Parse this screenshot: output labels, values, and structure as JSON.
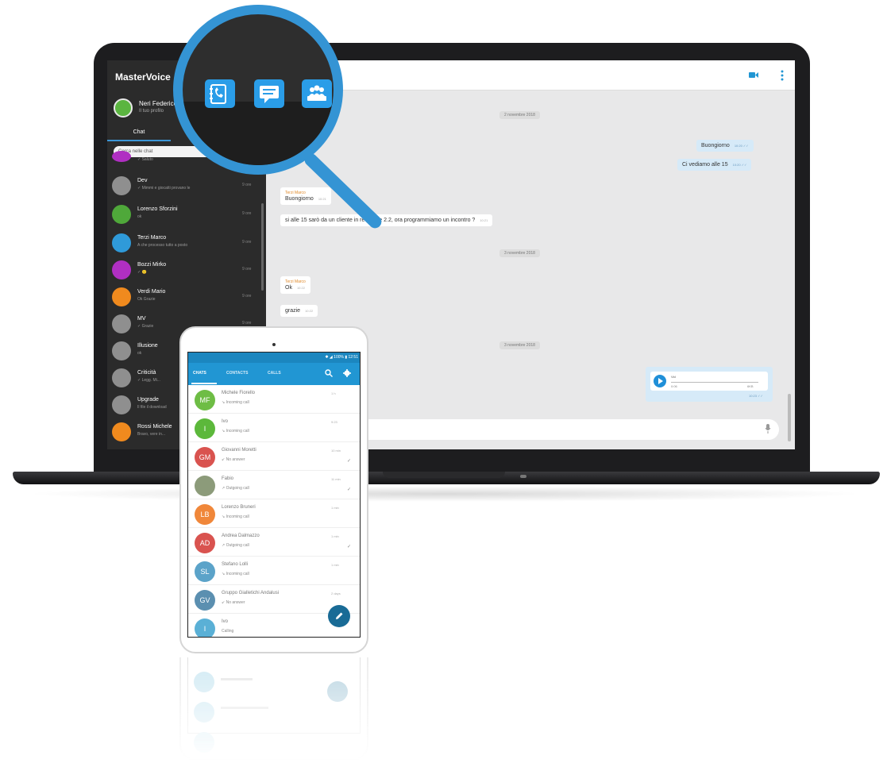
{
  "desktop_app": {
    "title": "MasterVoice",
    "profile": {
      "name": "Neri Federico",
      "status": "Il tuo profilo"
    },
    "tab_chat": "Chat",
    "search_placeholder": "Cerca nelle chat",
    "contacts": [
      {
        "name": "",
        "sub": "✓ Saluto",
        "time": "",
        "color": "#b02fc2"
      },
      {
        "name": "Dev",
        "sub": "✓ Mimmi e giocatti provano le",
        "time": "9 ore",
        "color": "#8f8f8f"
      },
      {
        "name": "Lorenzo Sforzini",
        "sub": "ok",
        "time": "9 ore",
        "color": "#4fa83a"
      },
      {
        "name": "Terzi Marco",
        "sub": "A che processo tutto a posto",
        "time": "9 ore",
        "color": "#2f9ad9"
      },
      {
        "name": "Bozzi Mirko",
        "sub": "✓ 🙂",
        "time": "9 ore",
        "color": "#b02fc2"
      },
      {
        "name": "Verdi Mario",
        "sub": "Ok Grazie",
        "time": "9 ore",
        "color": "#f08a1e"
      },
      {
        "name": "MV",
        "sub": "✓ Grazie",
        "time": "9 ore",
        "color": "#8f8f8f"
      },
      {
        "name": "Illusione",
        "sub": "ok",
        "time": "",
        "color": "#8f8f8f"
      },
      {
        "name": "Criticità",
        "sub": "✓ Legg. Mi...",
        "time": "",
        "color": "#8f8f8f"
      },
      {
        "name": "Upgrade",
        "sub": "Il file il download",
        "time": "",
        "color": "#8f8f8f"
      },
      {
        "name": "Rossi Michele",
        "sub": "Bravo, vere in...",
        "time": "",
        "color": "#f08a1e"
      }
    ],
    "chat": {
      "date_1": "2 novembre 2018",
      "date_2": "3 novembre 2018",
      "date_3": "3 novembre 2018",
      "msg_out_1": "Buongiorno",
      "msg_out_1_time": "10:20 ✓✓",
      "msg_out_2": "Ci vediamo alle 15",
      "msg_out_2_time": "10:20 ✓✓",
      "msg_in_1_sender": "Terzi Marco",
      "msg_in_1": "Buongiorno",
      "msg_in_1_time": "10:21",
      "msg_in_2": "si alle 15 sarò da un cliente in revisione 2.2, ora programmiamo un incontro ?",
      "msg_in_2_time": "10:21",
      "msg_in_3_sender": "Terzi Marco",
      "msg_in_3": "Ok",
      "msg_in_3_time": "10:22",
      "msg_in_4": "grazie",
      "msg_in_4_time": "10:22",
      "audio_label": "Vid",
      "audio_duration": "0:06",
      "audio_size": "6KB",
      "audio_time": "10:23 ✓✓"
    }
  },
  "magnifier_icons": [
    "phone-book-icon",
    "chat-message-icon",
    "group-icon"
  ],
  "mobile_app": {
    "status_bar": "✱ ◢ 100% ▮ 12:51",
    "tabs": [
      "CHATS",
      "CONTACTS",
      "CALLS"
    ],
    "rows": [
      {
        "initials": "MF",
        "name": "Michele Fiorello",
        "sub": "↘ Incoming call",
        "time": "1 h",
        "color": "#6ebd45"
      },
      {
        "initials": "I",
        "name": "Ivo",
        "sub": "↘ Incoming call",
        "time": "9:23",
        "color": "#5cb83b"
      },
      {
        "initials": "GM",
        "name": "Giovanni Moretti",
        "sub": "↙ No answer",
        "time": "10 min",
        "color": "#d9534f"
      },
      {
        "initials": "",
        "name": "Fabio",
        "sub": "↗ Outgoing call",
        "time": "11 min",
        "color": "#8c9b7a"
      },
      {
        "initials": "LB",
        "name": "Lorenzo Bruneri",
        "sub": "↘ Incoming call",
        "time": "1 min",
        "color": "#f0873a"
      },
      {
        "initials": "AD",
        "name": "Andrea Dalmazzo",
        "sub": "↗ Outgoing call",
        "time": "1 min",
        "color": "#d9534f"
      },
      {
        "initials": "SL",
        "name": "Stefano Lolli",
        "sub": "↘ Incoming call",
        "time": "1 min",
        "color": "#5ba3c9"
      },
      {
        "initials": "GV",
        "name": "Gruppo Gialletichi Andalusi",
        "sub": "↙ No answer",
        "time": "2 days",
        "color": "#5b8fb0"
      },
      {
        "initials": "I",
        "name": "Ivo",
        "sub": "Calling",
        "time": "",
        "color": "#5ab0d6"
      }
    ]
  }
}
